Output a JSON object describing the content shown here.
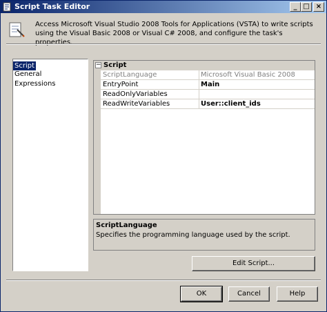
{
  "window": {
    "title": "Script Task Editor",
    "buttons": {
      "minimize": "_",
      "maximize": "□",
      "close": "×"
    }
  },
  "header": {
    "description": "Access Microsoft Visual Studio 2008 Tools for Applications (VSTA) to write scripts using the Visual Basic 2008 or Visual C# 2008, and configure the task's properties."
  },
  "nav": {
    "items": [
      {
        "label": "Script",
        "selected": true
      },
      {
        "label": "General",
        "selected": false
      },
      {
        "label": "Expressions",
        "selected": false
      }
    ]
  },
  "grid": {
    "category": "Script",
    "expander": "⊟",
    "properties": [
      {
        "name": "ScriptLanguage",
        "value": "Microsoft Visual Basic 2008",
        "readonly": true
      },
      {
        "name": "EntryPoint",
        "value": "Main",
        "bold": true
      },
      {
        "name": "ReadOnlyVariables",
        "value": ""
      },
      {
        "name": "ReadWriteVariables",
        "value": "User::client_ids",
        "bold": true
      }
    ]
  },
  "description_panel": {
    "title": "ScriptLanguage",
    "text": "Specifies the programming language used by the script."
  },
  "edit_script_label": "Edit Script...",
  "footer": {
    "ok": "OK",
    "cancel": "Cancel",
    "help": "Help"
  },
  "colors": {
    "titlebar_start": "#0a246a",
    "titlebar_end": "#a6caf0",
    "face": "#d4d0c8",
    "selection": "#0a246a"
  }
}
